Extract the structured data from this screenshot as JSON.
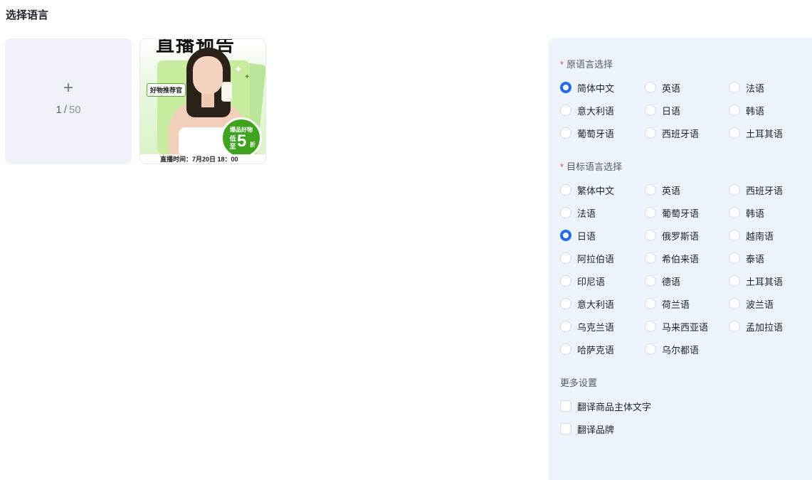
{
  "page": {
    "title": "选择语言"
  },
  "upload": {
    "plus": "+",
    "current": "1",
    "separator": "/",
    "total": "50"
  },
  "thumbnail": {
    "banner_title": "直播预告",
    "tag": "好物推荐官",
    "badge_top": "爆品好物",
    "badge_low": "低至",
    "badge_number": "5",
    "badge_unit": "折",
    "bottom_text": "直播时间：7月20日 18：00"
  },
  "source_lang": {
    "required_mark": "*",
    "label": "原语言选择",
    "selected": "简体中文",
    "options": [
      "简体中文",
      "英语",
      "法语",
      "意大利语",
      "日语",
      "韩语",
      "葡萄牙语",
      "西班牙语",
      "土耳其语"
    ]
  },
  "target_lang": {
    "required_mark": "*",
    "label": "目标语言选择",
    "selected": "日语",
    "options": [
      "繁体中文",
      "英语",
      "西班牙语",
      "法语",
      "葡萄牙语",
      "韩语",
      "日语",
      "俄罗斯语",
      "越南语",
      "阿拉伯语",
      "希伯来语",
      "泰语",
      "印尼语",
      "德语",
      "土耳其语",
      "意大利语",
      "荷兰语",
      "波兰语",
      "乌克兰语",
      "马来西亚语",
      "孟加拉语",
      "哈萨克语",
      "乌尔都语"
    ]
  },
  "more_settings": {
    "label": "更多设置",
    "options": [
      {
        "label": "翻译商品主体文字",
        "checked": false
      },
      {
        "label": "翻译品牌",
        "checked": false
      }
    ]
  },
  "colors": {
    "accent": "#1f6bf2",
    "panel_bg": "#eef4fd",
    "required": "#f5484a"
  }
}
